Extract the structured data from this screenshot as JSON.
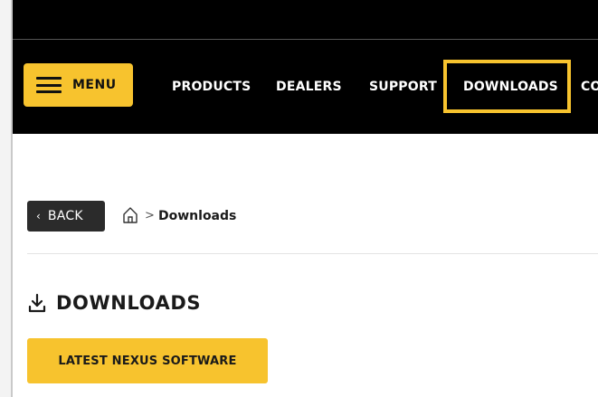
{
  "colors": {
    "accent": "#f7c32e",
    "header_bg": "#000000",
    "back_button_bg": "#2b2b2b"
  },
  "header": {
    "menu_label": "MENU",
    "nav": [
      "PRODUCTS",
      "DEALERS",
      "SUPPORT",
      "DOWNLOADS",
      "CO"
    ],
    "active_nav": "DOWNLOADS"
  },
  "breadcrumb": {
    "back_label": "BACK",
    "back_icon": "chevron-left-icon",
    "home_icon": "home-icon",
    "separator": ">",
    "current": "Downloads"
  },
  "main": {
    "title_icon": "download-icon",
    "title": "DOWNLOADS",
    "cta_label": "LATEST NEXUS SOFTWARE"
  }
}
